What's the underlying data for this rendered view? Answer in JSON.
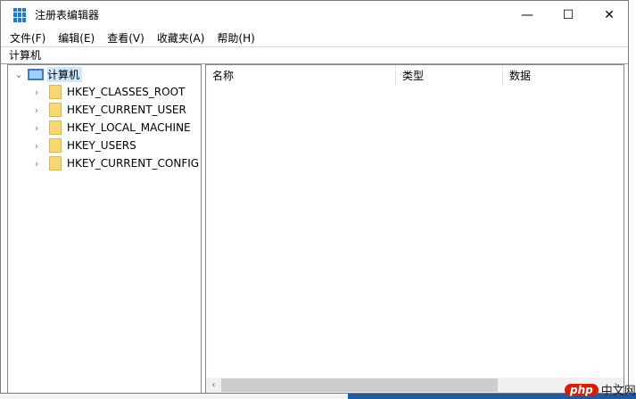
{
  "window": {
    "title": "注册表编辑器",
    "minimize": "—",
    "maximize": "☐",
    "close": "✕"
  },
  "menu": [
    "文件(F)",
    "编辑(E)",
    "查看(V)",
    "收藏夹(A)",
    "帮助(H)"
  ],
  "address": "计算机",
  "tree": {
    "root": "计算机",
    "keys": [
      "HKEY_CLASSES_ROOT",
      "HKEY_CURRENT_USER",
      "HKEY_LOCAL_MACHINE",
      "HKEY_USERS",
      "HKEY_CURRENT_CONFIG"
    ]
  },
  "columns": [
    "名称",
    "类型",
    "数据"
  ],
  "watermark": "php中文网"
}
